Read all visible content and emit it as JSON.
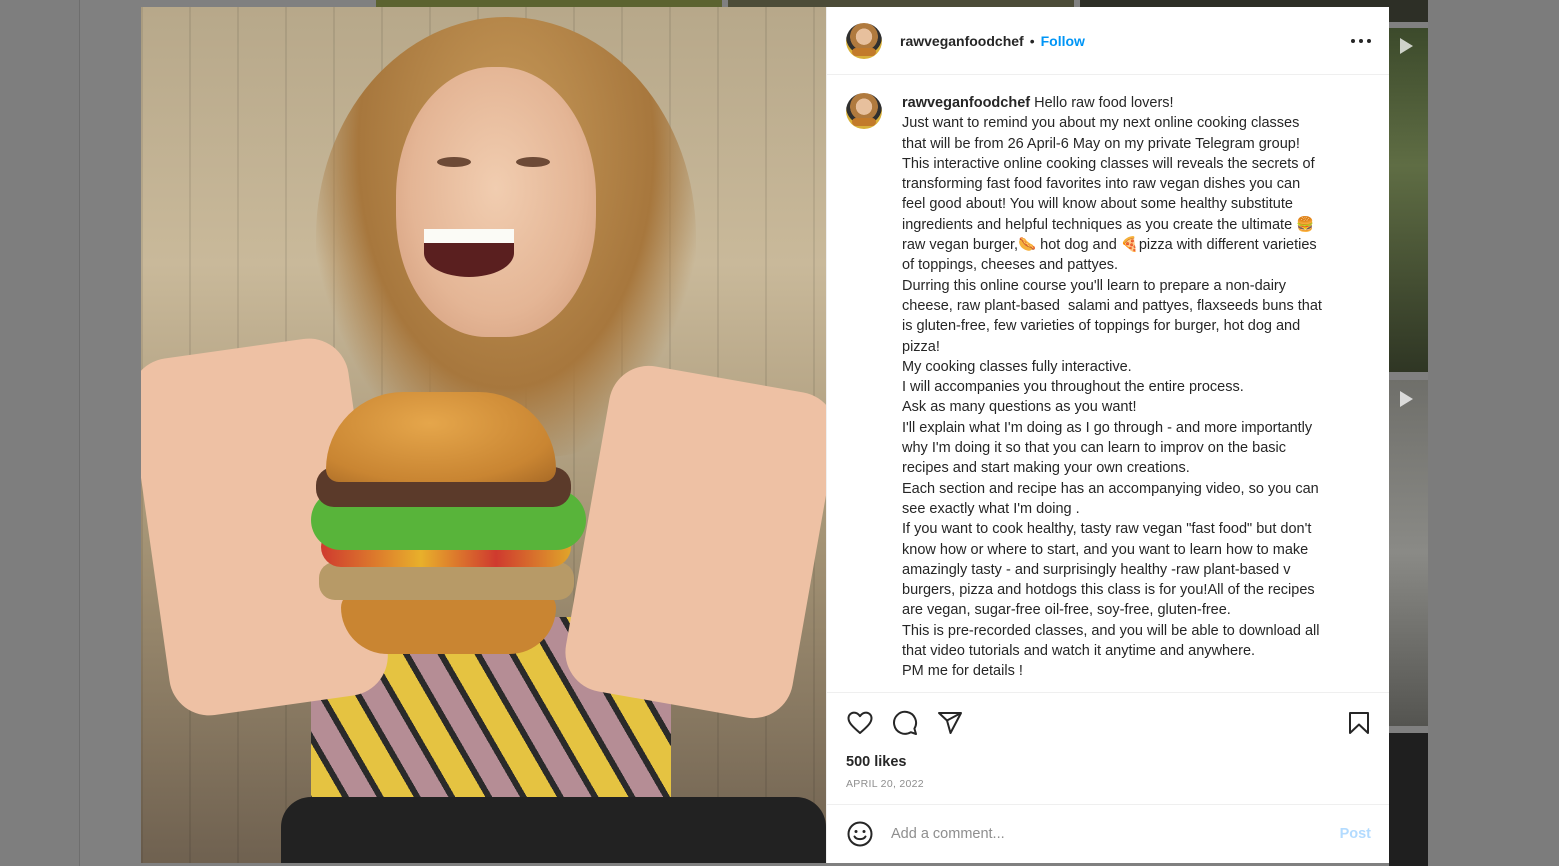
{
  "post": {
    "username": "rawveganfoodchef",
    "separator": "•",
    "follow_label": "Follow",
    "caption_user": "rawveganfoodchef",
    "caption_text": " Hello raw food lovers!\nJust want to remind you about my next online cooking classes\nthat will be from 26 April-6 May on my private Telegram group!\nThis interactive online cooking classes will reveals the secrets of\ntransforming fast food favorites into raw vegan dishes you can\nfeel good about! You will know about some healthy substitute\ningredients and helpful techniques as you create the ultimate 🍔\nraw vegan burger,🌭 hot dog and 🍕pizza with different varieties\nof toppings, cheeses and pattyes.\nDurring this online course you'll learn to prepare a non-dairy\ncheese, raw plant-based  salami and pattyes, flaxseeds buns that\nis gluten-free, few varieties of toppings for burger, hot dog and\npizza!\nMy cooking classes fully interactive.\nI will accompanies you throughout the entire process.\nAsk as many questions as you want!\nI'll explain what I'm doing as I go through - and more importantly\nwhy I'm doing it so that you can learn to improv on the basic\nrecipes and start making your own creations.\nEach section and recipe has an accompanying video, so you can\nsee exactly what I'm doing .\nIf you want to cook healthy, tasty raw vegan \"fast food\" but don't\nknow how or where to start, and you want to learn how to make\namazingly tasty - and surprisingly healthy -raw plant-based v\nburgers, pizza and hotdogs this class is for you!All of the recipes\nare vegan, sugar-free oil-free, soy-free, gluten-free.\nThis is pre-recorded classes, and you will be able to download all\nthat video tutorials and watch it anytime and anywhere.\nPM me for details !",
    "likes": "500 likes",
    "date": "April 20, 2022"
  },
  "comment_box": {
    "placeholder": "Add a comment...",
    "post_label": "Post"
  },
  "icons": {
    "more": "more-options-icon",
    "like": "heart-icon",
    "comment": "comment-icon",
    "share": "send-icon",
    "save": "bookmark-icon",
    "emoji": "emoji-icon"
  },
  "colors": {
    "accent": "#0095f6",
    "post_disabled": "#b3dbff",
    "text": "#262626",
    "muted": "#8e8e8e"
  }
}
